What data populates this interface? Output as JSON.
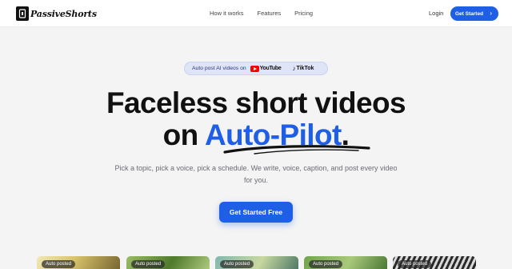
{
  "nav": {
    "brand": "PassiveShorts",
    "links": [
      "How it works",
      "Features",
      "Pricing"
    ],
    "login": "Login",
    "cta_label": "Get Started",
    "cta_icon": "chevron-right-icon"
  },
  "hero": {
    "pill_text": "Auto post AI videos on",
    "youtube_word": "YouTube",
    "tiktok_word": "TikTok",
    "headline_line1": "Faceless short videos",
    "headline_line2_prefix": "on ",
    "headline_line2_accent": "Auto-Pilot",
    "headline_line2_suffix": ".",
    "subtitle": "Pick a topic, pick a voice, pick a schedule. We write, voice, caption, and post every video for you.",
    "cta_label": "Get Started Free"
  },
  "cards": [
    {
      "badge": "Auto posted"
    },
    {
      "badge": "Auto posted"
    },
    {
      "badge": "Auto posted"
    },
    {
      "badge": "Auto posted"
    },
    {
      "badge": "Auto posted"
    }
  ],
  "colors": {
    "accent": "#1f5fe6",
    "background": "#f4f4f5",
    "text": "#111111",
    "youtube_red": "#ff0000"
  }
}
